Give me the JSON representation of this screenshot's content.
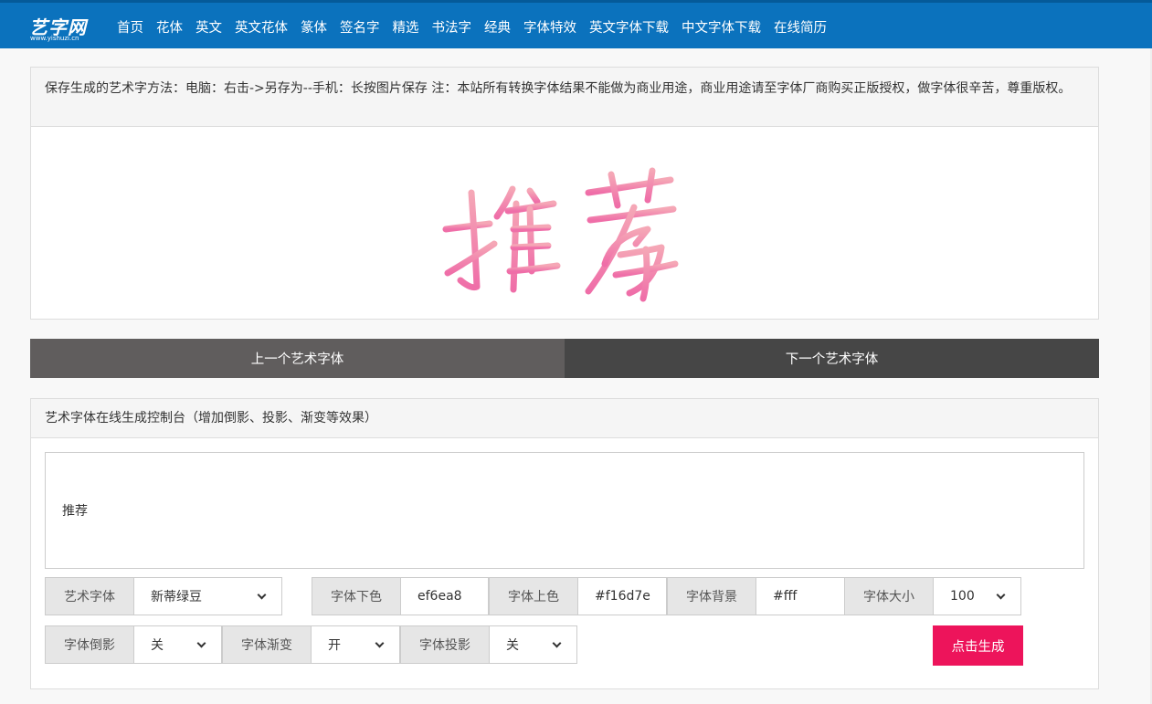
{
  "logo": {
    "main": "艺字网",
    "sub": "www.yishuzi.cn"
  },
  "nav": [
    "首页",
    "花体",
    "英文",
    "英文花体",
    "篆体",
    "签名字",
    "精选",
    "书法字",
    "经典",
    "字体特效",
    "英文字体下载",
    "中文字体下载",
    "在线简历"
  ],
  "notice": "保存生成的艺术字方法：电脑：右击->另存为--手机：长按图片保存 注：本站所有转换字体结果不能做为商业用途，商业用途请至字体厂商购买正版授权，做字体很辛苦，尊重版权。",
  "preview": {
    "text": "推荐",
    "color_bottom": "#ef6ea8",
    "color_top": "#f16d7e"
  },
  "prev_label": "上一个艺术字体",
  "next_label": "下一个艺术字体",
  "console_title": "艺术字体在线生成控制台（增加倒影、投影、渐变等效果）",
  "input_text": "推荐",
  "controls": {
    "font_label": "艺术字体",
    "font_value": "新蒂绿豆",
    "color_bottom_label": "字体下色",
    "color_bottom_value": "ef6ea8",
    "color_top_label": "字体上色",
    "color_top_value": "#f16d7e",
    "bg_label": "字体背景",
    "bg_value": "#fff",
    "size_label": "字体大小",
    "size_value": "100",
    "reflection_label": "字体倒影",
    "reflection_value": "关",
    "gradient_label": "字体渐变",
    "gradient_value": "开",
    "shadow_label": "字体投影",
    "shadow_value": "关"
  },
  "generate_label": "点击生成"
}
